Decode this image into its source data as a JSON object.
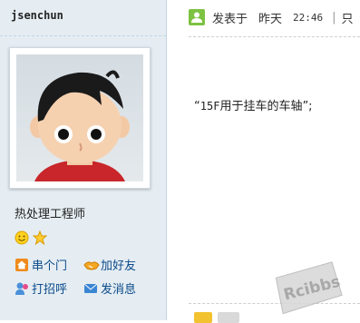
{
  "user": {
    "name": "jsenchun",
    "title": "热处理工程师",
    "actions": {
      "visit": "串个门",
      "add_friend": "加好友",
      "greet": "打招呼",
      "message": "发消息"
    }
  },
  "post": {
    "posted_label": "发表于",
    "date": "昨天",
    "time": "22:46",
    "only_label": "只",
    "quote_open": "“",
    "content_code": "15F",
    "content_text": "用于挂车的车轴”;"
  },
  "watermark": {
    "text": "Rcibbs"
  },
  "colors": {
    "sidebar_bg": "#e5edf2",
    "link": "#0b4a8b",
    "post_icon": "#7dc243"
  }
}
